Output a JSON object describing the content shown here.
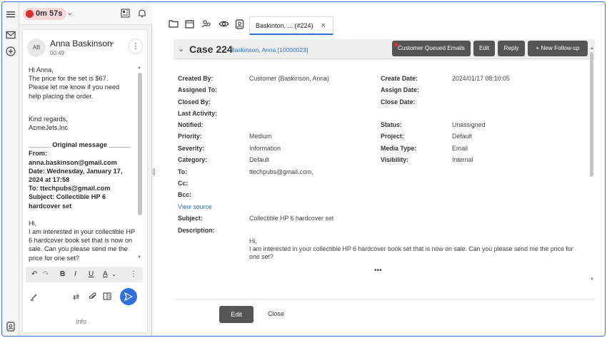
{
  "rail": {
    "icons": [
      "menu-icon",
      "mail-icon",
      "add-circle-icon",
      "contact-card-icon"
    ]
  },
  "left_panel": {
    "timer": "0m 57s",
    "email": {
      "avatar_initials": "AB",
      "sender": "Anna Baskinson",
      "time": "00:49",
      "greeting": "Hi Anna,",
      "body1": "The price for the set is $67.\nPlease let me know if you need\nhelp placing the order.",
      "signoff": "Kind regards,\nAcmeJets.Inc",
      "orig_header": "______ Original message ______",
      "orig_from_label": "From:",
      "orig_from": "anna.baskinson@gmail.com",
      "orig_date": "Date: Wednesday, January 17, 2024 at 17:58",
      "orig_to": "To: ttechpubs@gmail.com",
      "orig_subject": "Subject: Collectible HP 6 hardcover set",
      "reply_hi": "Hi,",
      "reply_body": "I am interested in your collectible HP 6 hardcover book set that is now on sale. Can you please send me the price for one set?"
    },
    "format_bar": {
      "bold": "B",
      "italic": "I",
      "underline": "U",
      "color": "A"
    },
    "info_label": "Info"
  },
  "main": {
    "tab": {
      "label": "Baskinton, ... (#224)"
    },
    "case": {
      "title": "Case 224",
      "customer_link": "Baskinson, Anna [10000023]",
      "buttons": {
        "queued": "Customer Queued Emails",
        "edit": "Edit",
        "reply": "Reply",
        "follow_up": "+ New Follow-up"
      },
      "labels": {
        "created_by": "Created By:",
        "assigned_to": "Assigned To:",
        "closed_by": "Closed By:",
        "last_activity": "Last Activity:",
        "notified": "Notified:",
        "priority": "Priority:",
        "severity": "Severity:",
        "category": "Category:",
        "to": "To:",
        "cc": "Cc:",
        "bcc": "Bcc:",
        "subject": "Subject:",
        "description": "Description:",
        "create_date": "Create Date:",
        "assign_date": "Assign Date:",
        "close_date": "Close Date:",
        "status": "Status:",
        "project": "Project:",
        "media_type": "Media Type:",
        "visibility": "Visibility:"
      },
      "values": {
        "created_by": "Customer (Baskinson, Anna)",
        "create_date": "2024/01/17 08:10:05",
        "status": "Unassigned",
        "priority": "Medium",
        "project": "Default",
        "severity": "Information",
        "media_type": "Email",
        "category": "Default",
        "visibility": "Internal",
        "to": "ttechpubs@gmail.com,",
        "view_source": "View source",
        "subject": "Collectible HP 6 hardcover set",
        "description_hi": "Hi,",
        "description_body": "I am interested in your collectible HP 6 hardcover book set that is now on sale. Can you please send me the price for one set?"
      },
      "ellipsis": "•••",
      "footer": {
        "edit": "Edit",
        "close": "Close"
      }
    }
  }
}
